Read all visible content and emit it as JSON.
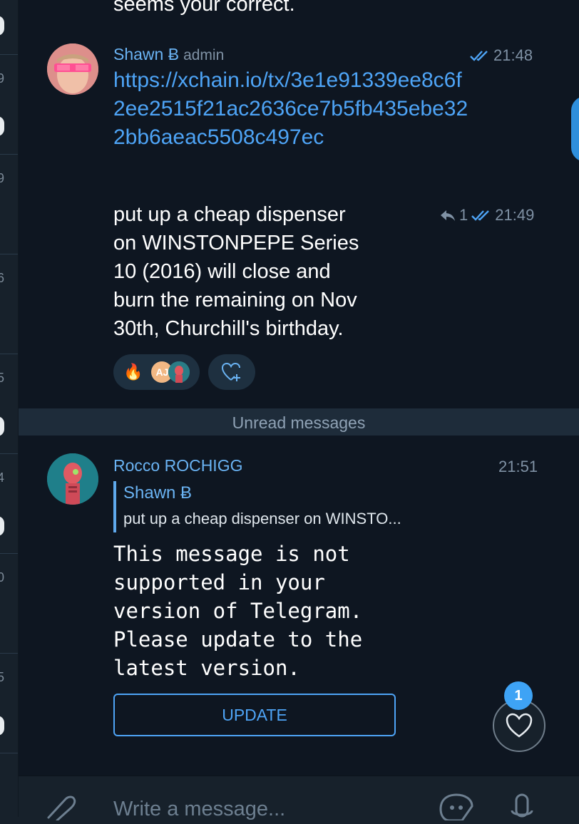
{
  "sidebar": {
    "counters": [
      "9",
      "9",
      "6",
      "5",
      "4",
      "0",
      "5"
    ]
  },
  "messages": {
    "top_text": "seems your correct.",
    "shawn": {
      "name": "Shawn Ƀ",
      "role": "admin",
      "link_time": "21:48",
      "link": "https://xchain.io/tx/3e1e91339ee8c6f2ee2515f21ac2636ce7b5fb435ebe322bb6aeac5508c497ec",
      "text_lines": [
        "put up a cheap dispenser",
        "on WINSTONPEPE Series",
        "10 (2016) will close and",
        "burn the remaining on Nov",
        "30th, Churchill's birthday."
      ],
      "reply_count": "1",
      "text_time": "21:49",
      "reaction_emoji": "🔥",
      "reactor_initials": "AJ"
    },
    "unread_label": "Unread messages",
    "rocco": {
      "name": "Rocco ROCHIGG",
      "time": "21:51",
      "reply_to_name": "Shawn Ƀ",
      "reply_to_text": "put up a cheap dispenser on WINSTO...",
      "body": "This message is not\nsupported in your\nversion of Telegram.\nPlease update to the\nlatest version.",
      "update_label": "UPDATE"
    }
  },
  "reaction_button": {
    "badge": "1"
  },
  "composer": {
    "placeholder": "Write a message..."
  },
  "colors": {
    "accent": "#4ea4f6",
    "sender_name": "#6ab3f3",
    "background": "#0e1621"
  }
}
